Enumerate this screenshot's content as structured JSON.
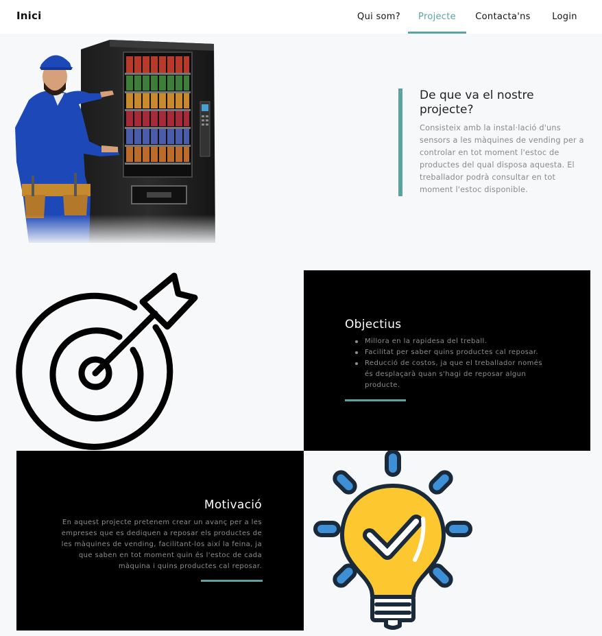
{
  "navbar": {
    "brand": "Inici",
    "links": [
      {
        "label": "Qui som?",
        "active": false
      },
      {
        "label": "Projecte",
        "active": true
      },
      {
        "label": "Contacta'ns",
        "active": false
      },
      {
        "label": "Login",
        "active": false
      }
    ]
  },
  "intro": {
    "title": "De que va el nostre projecte?",
    "text": "Consisteix amb la instal·lació d'uns sensors a les màquines de vending per a controlar en tot moment l'estoc de productes del qual disposa aquesta. El treballador podrà consultar en tot moment l'estoc disponible."
  },
  "objectius": {
    "title": "Objectius",
    "items": [
      "Millora en la rapidesa del treball.",
      "Facilitat per saber quins productes cal reposar.",
      "Reducció de costos, ja que el treballador només és desplaçarà quan s'hagi de reposar algun producte."
    ]
  },
  "motivacio": {
    "title": "Motivació",
    "text": "En aquest projecte pretenem crear un avanç per a les empreses que es dediquen a reposar els productes de les màquines de vending, facilitant-los així la feina, ja que saben en tot moment quin és l'estoc de cada màquina i quins productes cal reposar."
  },
  "colors": {
    "accent": "#5ba3a0",
    "dark_panel": "#000000",
    "background": "#f7f8fa",
    "bulb_yellow": "#fdc82f",
    "bulb_blue": "#3d8fd6",
    "bulb_outline": "#1a2a3a"
  },
  "icons": {
    "hero": "vending-machine-worker-illustration",
    "objectius": "target-arrow-icon",
    "motivacio": "lightbulb-check-icon"
  }
}
